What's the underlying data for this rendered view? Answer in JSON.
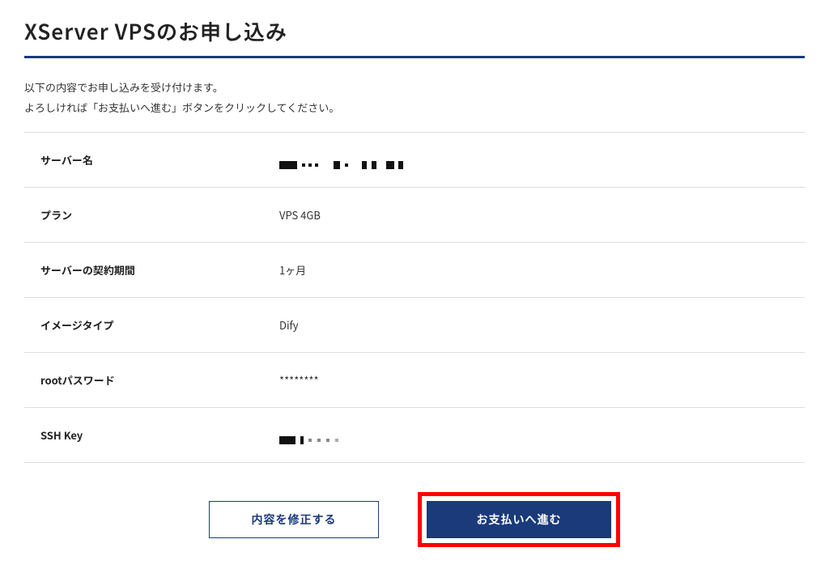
{
  "header": {
    "title": "XServer VPSのお申し込み"
  },
  "intro": {
    "line1": "以下の内容でお申し込みを受け付けます。",
    "line2": "よろしければ「お支払いへ進む」ボタンをクリックしてください。"
  },
  "summary": {
    "server_name_label": "サーバー名",
    "plan_label": "プラン",
    "plan_value": "VPS 4GB",
    "contract_period_label": "サーバーの契約期間",
    "contract_period_value": "1ヶ月",
    "image_type_label": "イメージタイプ",
    "image_type_value": "Dify",
    "root_password_label": "rootパスワード",
    "root_password_value": "********",
    "ssh_key_label": "SSH Key"
  },
  "actions": {
    "edit_label": "内容を修正する",
    "proceed_label": "お支払いへ進む"
  }
}
